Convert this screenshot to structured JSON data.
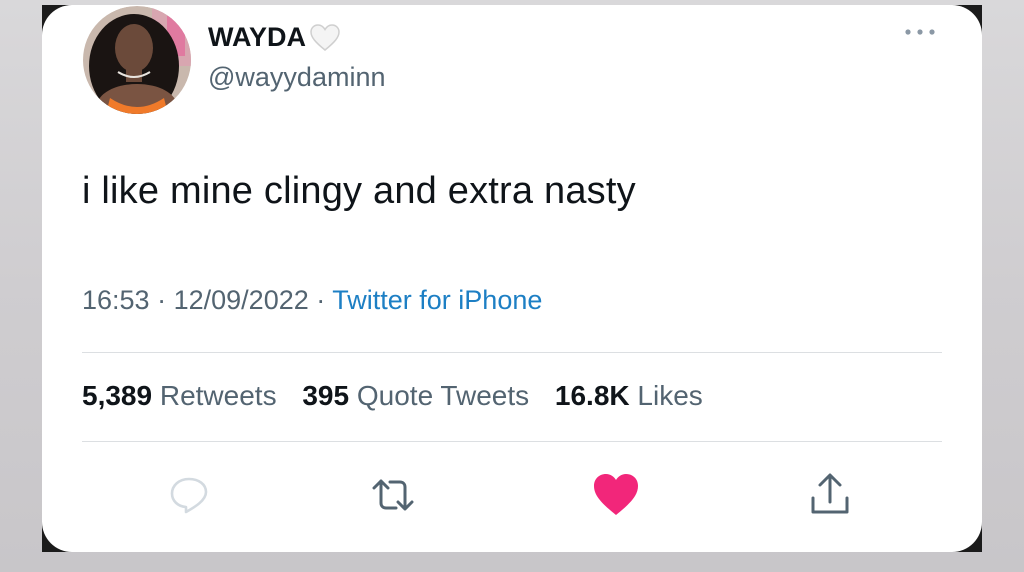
{
  "author": {
    "display_name": "WAYDA",
    "handle": "@wayydaminn"
  },
  "tweet": {
    "text": "i like mine clingy and extra nasty",
    "time": "16:53",
    "date": "12/09/2022",
    "source": "Twitter for iPhone",
    "sep": "·"
  },
  "stats": {
    "retweets_count": "5,389",
    "retweets_label": "Retweets",
    "quotes_count": "395",
    "quotes_label": "Quote Tweets",
    "likes_count": "16.8K",
    "likes_label": "Likes"
  },
  "icons": {
    "verified_badge": "white-heart-icon",
    "more": "more-dots-icon",
    "reply": "reply-icon",
    "retweet": "retweet-icon",
    "like": "like-heart-icon",
    "share": "share-icon"
  },
  "colors": {
    "link": "#1d7fc4",
    "like": "#f2267a",
    "muted": "#536471"
  }
}
